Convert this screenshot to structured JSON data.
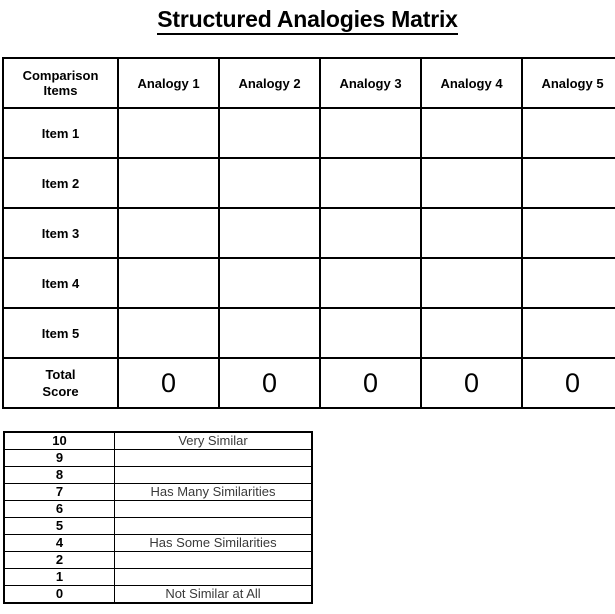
{
  "title": "Structured Analogies Matrix",
  "matrix": {
    "corner_header": "Comparison Items",
    "corner_header_line1": "Comparison",
    "corner_header_line2": "Items",
    "column_headers": [
      "Analogy 1",
      "Analogy 2",
      "Analogy 3",
      "Analogy 4",
      "Analogy 5"
    ],
    "row_headers": [
      "Item 1",
      "Item 2",
      "Item 3",
      "Item 4",
      "Item 5"
    ],
    "total_row_label_line1": "Total",
    "total_row_label_line2": "Score",
    "total_row_label": "Total Score",
    "cell_values": [
      [
        "",
        "",
        "",
        "",
        ""
      ],
      [
        "",
        "",
        "",
        "",
        ""
      ],
      [
        "",
        "",
        "",
        "",
        ""
      ],
      [
        "",
        "",
        "",
        "",
        ""
      ],
      [
        "",
        "",
        "",
        "",
        ""
      ]
    ],
    "totals": [
      "0",
      "0",
      "0",
      "0",
      "0"
    ]
  },
  "legend": {
    "rows": [
      {
        "score": "10",
        "label": "Very Similar"
      },
      {
        "score": "9",
        "label": ""
      },
      {
        "score": "8",
        "label": ""
      },
      {
        "score": "7",
        "label": "Has Many Similarities"
      },
      {
        "score": "6",
        "label": ""
      },
      {
        "score": "5",
        "label": ""
      },
      {
        "score": "4",
        "label": "Has Some Similarities"
      },
      {
        "score": "2",
        "label": ""
      },
      {
        "score": "1",
        "label": ""
      },
      {
        "score": "0",
        "label": "Not Similar at All"
      }
    ]
  },
  "colors": {
    "border": "#000000",
    "header_gradient_light": "#fdfdfd",
    "header_gradient_dark": "#8d8d8d",
    "background": "#ffffff",
    "text": "#000000"
  }
}
